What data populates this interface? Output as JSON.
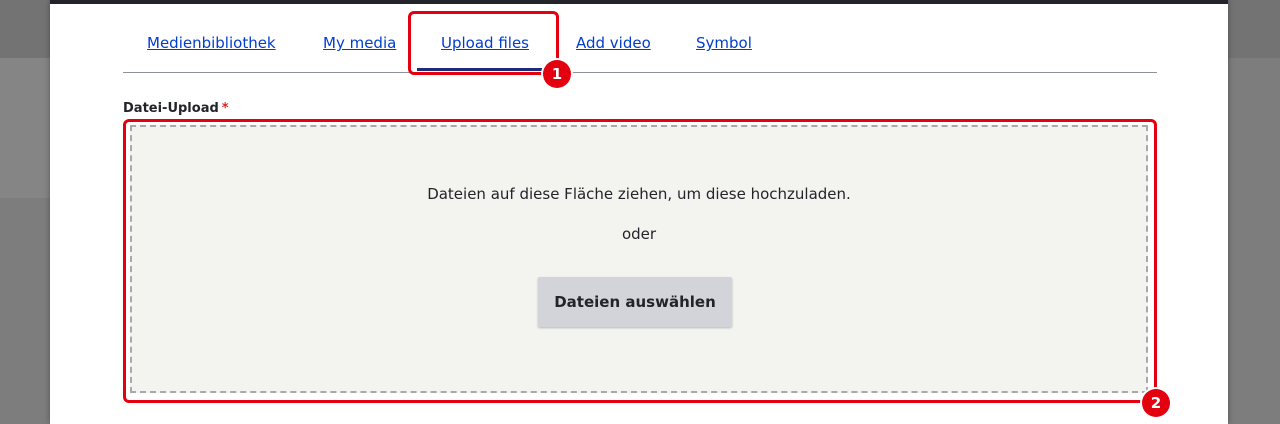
{
  "tabs": [
    {
      "label": "Medienbibliothek",
      "active": false
    },
    {
      "label": "My media",
      "active": false
    },
    {
      "label": "Upload files",
      "active": true
    },
    {
      "label": "Add video",
      "active": false
    },
    {
      "label": "Symbol",
      "active": false
    }
  ],
  "field": {
    "label": "Datei-Upload",
    "required_mark": "*"
  },
  "dropzone": {
    "hint": "Dateien auf diese Fläche ziehen, um diese hochzuladen.",
    "or": "oder",
    "button_label": "Dateien auswählen"
  },
  "annotations": {
    "badge_1": "1",
    "badge_2": "2"
  },
  "colors": {
    "link": "#003ecc",
    "highlight": "#e3000f",
    "dropzone_bg": "#f3f4f0",
    "required": "#dc2323"
  }
}
